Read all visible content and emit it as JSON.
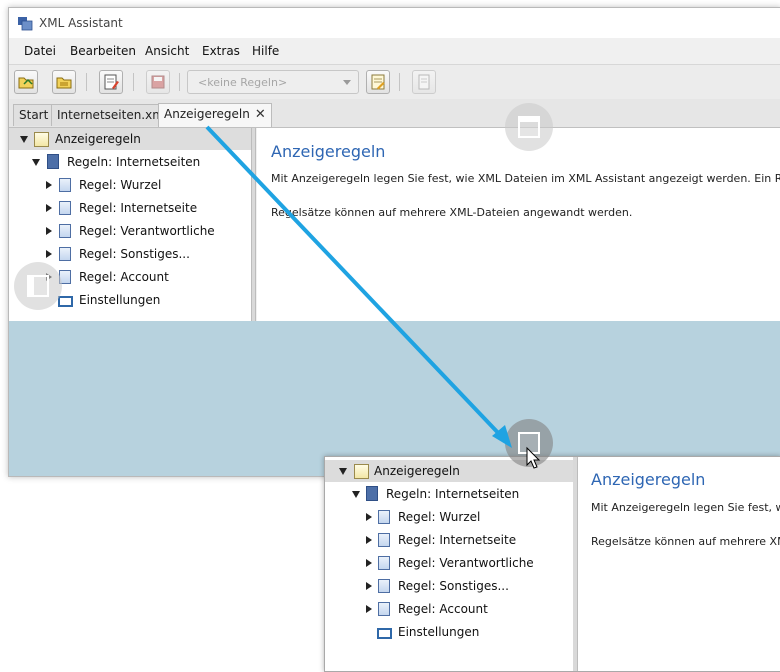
{
  "window": {
    "title": "XML Assistant",
    "menu": [
      "Datei",
      "Bearbeiten",
      "Ansicht",
      "Extras",
      "Hilfe"
    ],
    "toolbar": {
      "rules_combo_placeholder": "<keine Regeln>"
    },
    "tabs": [
      {
        "label": "Start",
        "active": false
      },
      {
        "label": "Internetseiten.xml",
        "active": false
      },
      {
        "label": "Anzeigeregeln",
        "active": true,
        "close": "✕"
      }
    ]
  },
  "tree": {
    "root": "Anzeigeregeln",
    "ruleset": "Regeln: Internetseiten",
    "rules": [
      "Regel: Wurzel",
      "Regel: Internetseite",
      "Regel: Verantwortliche",
      "Regel: Sonstiges...",
      "Regel: Account"
    ],
    "settings": "Einstellungen"
  },
  "content": {
    "title": "Anzeigeregeln",
    "paragraph1": "Mit Anzeigeregeln legen Sie fest, wie XML Dateien im XML Assistant angezeigt werden. Ein Regelsatz",
    "paragraph2": "Regelsätze können auf mehrere XML-Dateien angewandt werden."
  },
  "colors": {
    "accent_title": "#2e66b3",
    "dock_highlight": "#b7d2de",
    "drag_arrow": "#1fa3e2"
  }
}
